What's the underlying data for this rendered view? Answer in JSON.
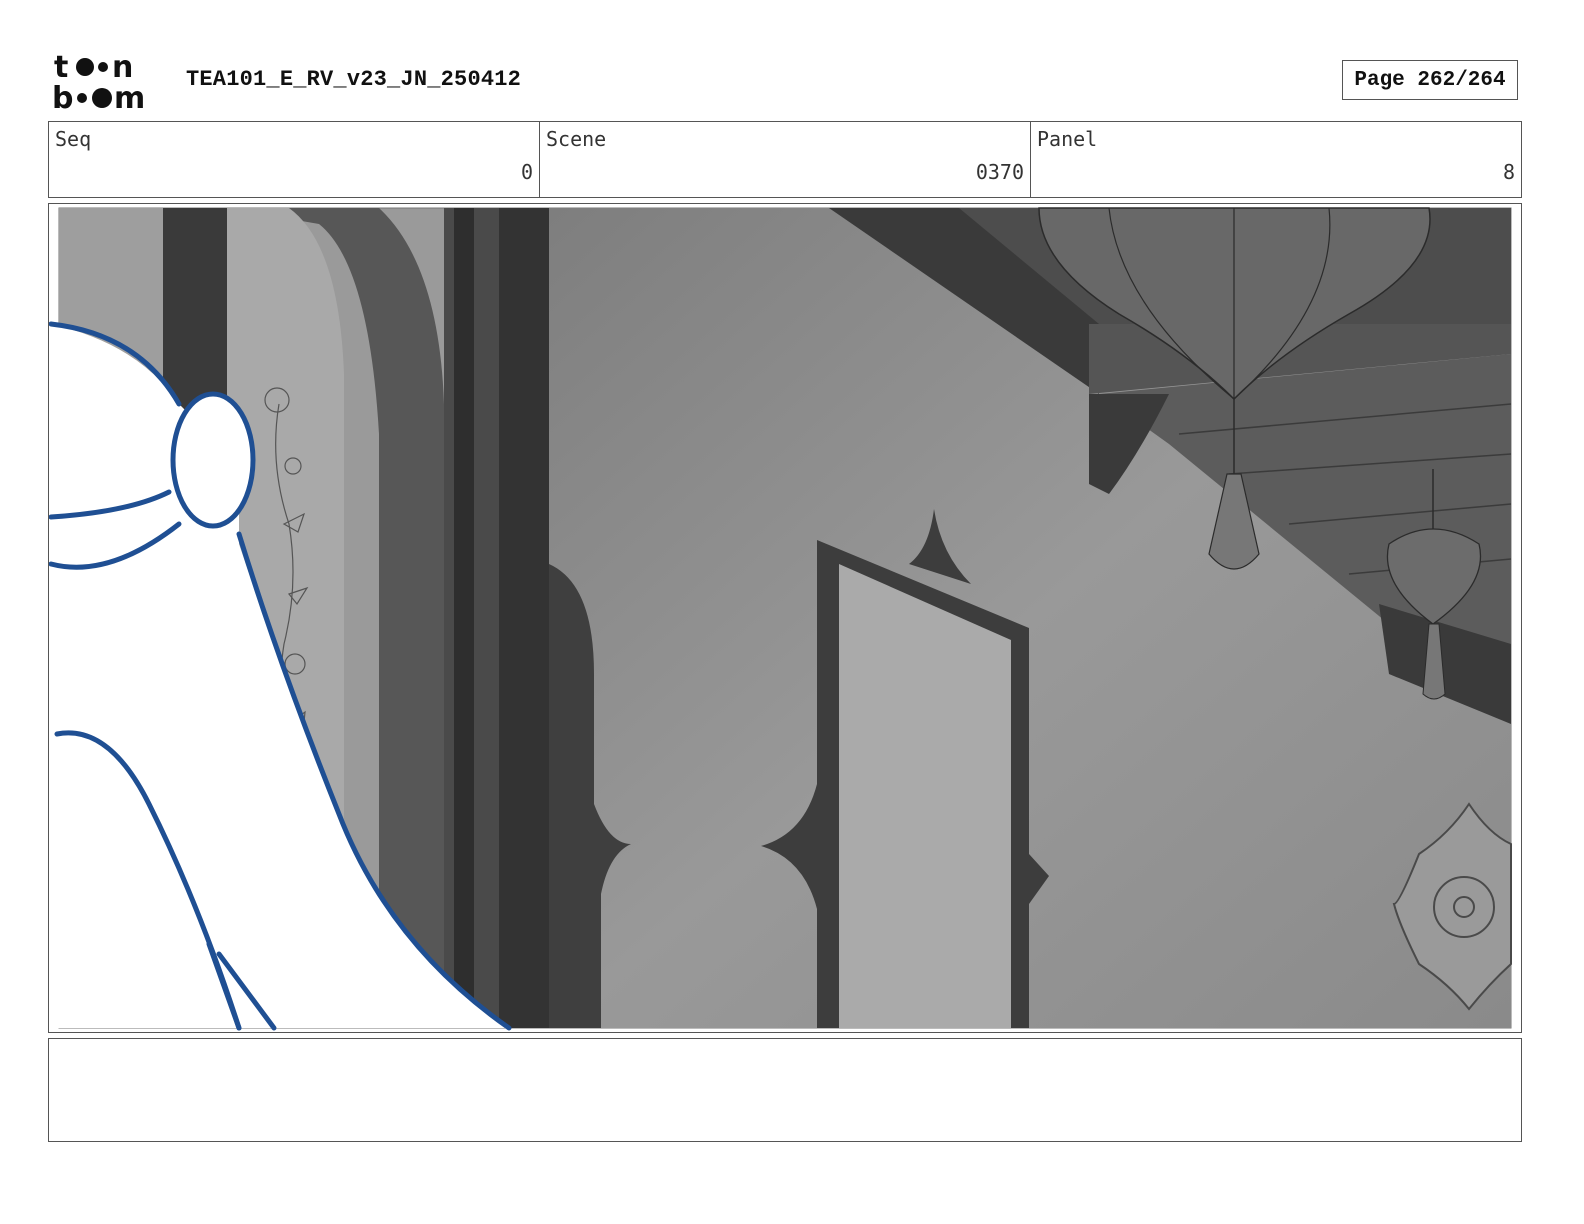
{
  "header": {
    "logo_text": "toon boom",
    "title": "TEA101_E_RV_v23_JN_250412",
    "page": "Page 262/264"
  },
  "info": {
    "seq_label": "Seq",
    "seq_value": "0",
    "scene_label": "Scene",
    "scene_value": "0370",
    "panel_label": "Panel",
    "panel_value": "8"
  },
  "colors": {
    "character_outline": "#1f4f93",
    "wall": "#8a8a8a",
    "dark_wood": "#3c3c3c",
    "mirror": "#aaaaaa"
  },
  "notes": {
    "text": ""
  }
}
